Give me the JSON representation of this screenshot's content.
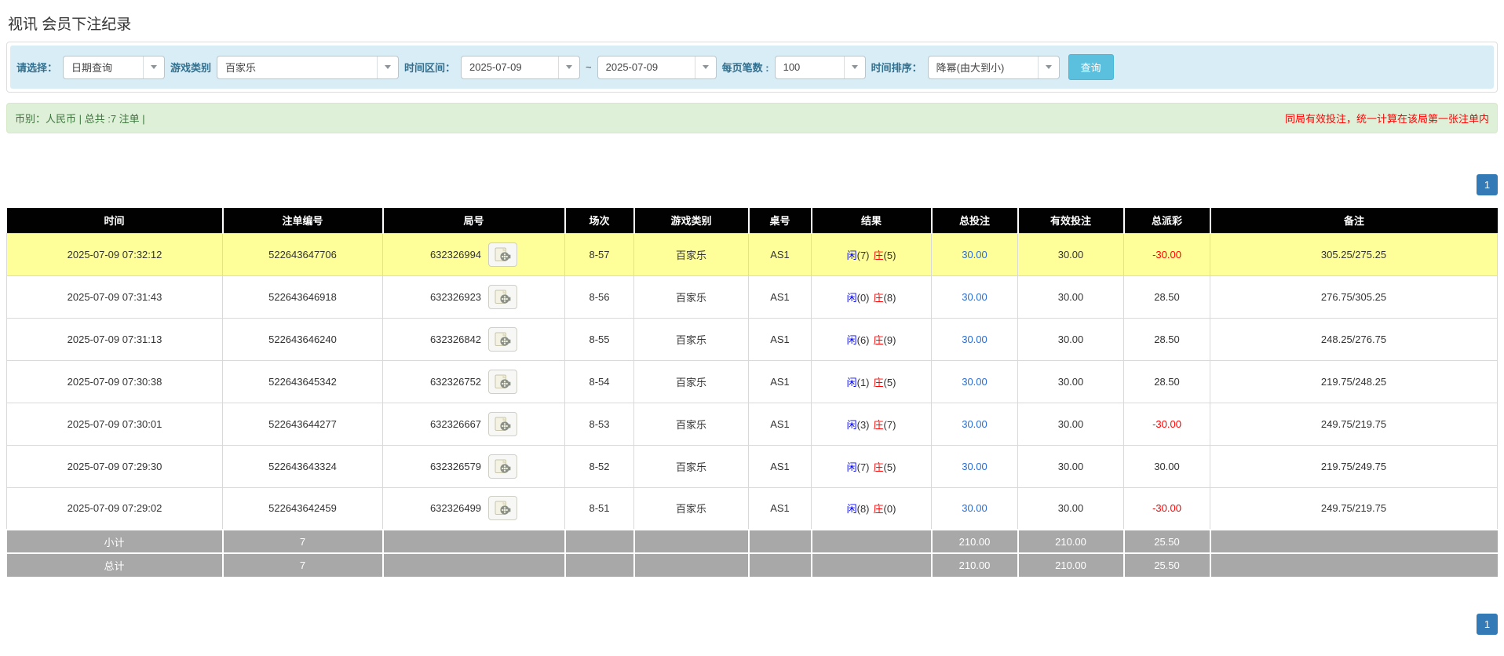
{
  "page": {
    "title": "视讯 会员下注纪录"
  },
  "filters": {
    "select_label": "请选择：",
    "select_value": "日期查询",
    "game_label": "游戏类别",
    "game_value": "百家乐",
    "range_label": "时间区间：",
    "range_from": "2025-07-09",
    "range_sep": "~",
    "range_to": "2025-07-09",
    "page_size_label": "每页笔数 :",
    "page_size_value": "100",
    "sort_label": "时间排序：",
    "sort_value": "降幂(由大到小)",
    "search_button": "查询"
  },
  "summary": {
    "left": "币别：人民币 | 总共 :7 注单 |",
    "notice": "同局有效投注，统一计算在该局第一张注单内"
  },
  "pagination": {
    "page": "1"
  },
  "table": {
    "headers": [
      "时间",
      "注单编号",
      "局号",
      "场次",
      "游戏类别",
      "桌号",
      "结果",
      "总投注",
      "有效投注",
      "总派彩",
      "备注"
    ],
    "result_labels": {
      "player": "闲",
      "banker": "庄"
    },
    "rows": [
      {
        "time": "2025-07-09 07:32:12",
        "bet_id": "522643647706",
        "round_id": "632326994",
        "session": "8-57",
        "game": "百家乐",
        "table": "AS1",
        "player_score": "(7)",
        "banker_score": "(5)",
        "total_bet": "30.00",
        "valid_bet": "30.00",
        "payout": "-30.00",
        "remark": "305.25/275.25",
        "highlight": true
      },
      {
        "time": "2025-07-09 07:31:43",
        "bet_id": "522643646918",
        "round_id": "632326923",
        "session": "8-56",
        "game": "百家乐",
        "table": "AS1",
        "player_score": "(0)",
        "banker_score": "(8)",
        "total_bet": "30.00",
        "valid_bet": "30.00",
        "payout": "28.50",
        "remark": "276.75/305.25",
        "highlight": false
      },
      {
        "time": "2025-07-09 07:31:13",
        "bet_id": "522643646240",
        "round_id": "632326842",
        "session": "8-55",
        "game": "百家乐",
        "table": "AS1",
        "player_score": "(6)",
        "banker_score": "(9)",
        "total_bet": "30.00",
        "valid_bet": "30.00",
        "payout": "28.50",
        "remark": "248.25/276.75",
        "highlight": false
      },
      {
        "time": "2025-07-09 07:30:38",
        "bet_id": "522643645342",
        "round_id": "632326752",
        "session": "8-54",
        "game": "百家乐",
        "table": "AS1",
        "player_score": "(1)",
        "banker_score": "(5)",
        "total_bet": "30.00",
        "valid_bet": "30.00",
        "payout": "28.50",
        "remark": "219.75/248.25",
        "highlight": false
      },
      {
        "time": "2025-07-09 07:30:01",
        "bet_id": "522643644277",
        "round_id": "632326667",
        "session": "8-53",
        "game": "百家乐",
        "table": "AS1",
        "player_score": "(3)",
        "banker_score": "(7)",
        "total_bet": "30.00",
        "valid_bet": "30.00",
        "payout": "-30.00",
        "remark": "249.75/219.75",
        "highlight": false
      },
      {
        "time": "2025-07-09 07:29:30",
        "bet_id": "522643643324",
        "round_id": "632326579",
        "session": "8-52",
        "game": "百家乐",
        "table": "AS1",
        "player_score": "(7)",
        "banker_score": "(5)",
        "total_bet": "30.00",
        "valid_bet": "30.00",
        "payout": "30.00",
        "remark": "219.75/249.75",
        "highlight": false
      },
      {
        "time": "2025-07-09 07:29:02",
        "bet_id": "522643642459",
        "round_id": "632326499",
        "session": "8-51",
        "game": "百家乐",
        "table": "AS1",
        "player_score": "(8)",
        "banker_score": "(0)",
        "total_bet": "30.00",
        "valid_bet": "30.00",
        "payout": "-30.00",
        "remark": "249.75/219.75",
        "highlight": false
      }
    ],
    "subtotal": {
      "label": "小计",
      "count": "7",
      "total_bet": "210.00",
      "valid_bet": "210.00",
      "payout": "25.50"
    },
    "total": {
      "label": "总计",
      "count": "7",
      "total_bet": "210.00",
      "valid_bet": "210.00",
      "payout": "25.50"
    }
  }
}
